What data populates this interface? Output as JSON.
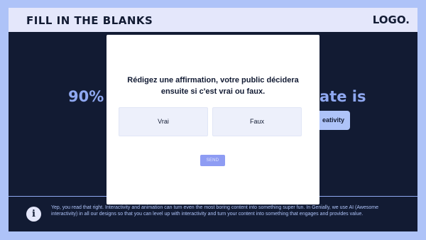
{
  "header": {
    "title": "FILL IN THE BLANKS",
    "logo": "LOGO."
  },
  "background": {
    "stat_text": "90%",
    "partial_text": "ate is",
    "partial_button": "eativity"
  },
  "footer": {
    "info_icon": "i",
    "text": "Yep, you read that right. Interactivity and animation can turn even the most boring content into something super fun. In Genially, we use AI (Awesome interactivity) in all our designs so that you can level up with interactivity and turn your content into something that engages and provides value."
  },
  "modal": {
    "prompt": "Rédigez une affirmation, votre public décidera ensuite si c'est vrai ou faux.",
    "choices": [
      "Vrai",
      "Faux"
    ],
    "send_label": "SEND"
  },
  "colors": {
    "page_bg": "#aec3f8",
    "slide_bg": "#121b33",
    "header_bg": "#e4e7fb",
    "accent": "#8fa8f1",
    "send_button": "#8e9cf3"
  },
  "icons": {
    "info": "info-icon"
  }
}
